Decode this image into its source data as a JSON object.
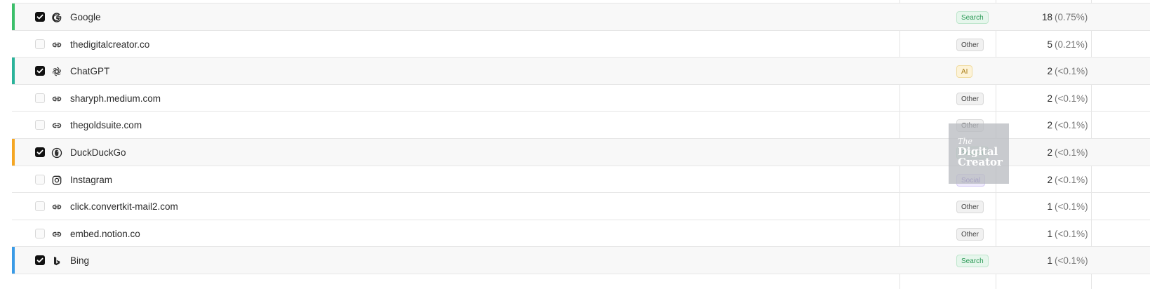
{
  "rows": [
    {
      "name": "Google",
      "checked": true,
      "icon": "google-icon",
      "accent": "#3cbf6a",
      "badge": "Search",
      "count": "18",
      "percent": "(0.75%)"
    },
    {
      "name": "thedigitalcreator.co",
      "checked": false,
      "icon": "link-icon",
      "accent": "",
      "badge": "Other",
      "count": "5",
      "percent": "(0.21%)"
    },
    {
      "name": "ChatGPT",
      "checked": true,
      "icon": "openai-icon",
      "accent": "#2bb39a",
      "badge": "AI",
      "count": "2",
      "percent": "(<0.1%)"
    },
    {
      "name": "sharyph.medium.com",
      "checked": false,
      "icon": "link-icon",
      "accent": "",
      "badge": "Other",
      "count": "2",
      "percent": "(<0.1%)"
    },
    {
      "name": "thegoldsuite.com",
      "checked": false,
      "icon": "link-icon",
      "accent": "",
      "badge": "Other",
      "count": "2",
      "percent": "(<0.1%)"
    },
    {
      "name": "DuckDuckGo",
      "checked": true,
      "icon": "duckduckgo-icon",
      "accent": "#f5a623",
      "badge": "Search",
      "count": "2",
      "percent": "(<0.1%)"
    },
    {
      "name": "Instagram",
      "checked": false,
      "icon": "instagram-icon",
      "accent": "",
      "badge": "Social",
      "count": "2",
      "percent": "(<0.1%)"
    },
    {
      "name": "click.convertkit-mail2.com",
      "checked": false,
      "icon": "link-icon",
      "accent": "",
      "badge": "Other",
      "count": "1",
      "percent": "(<0.1%)"
    },
    {
      "name": "embed.notion.co",
      "checked": false,
      "icon": "link-icon",
      "accent": "",
      "badge": "Other",
      "count": "1",
      "percent": "(<0.1%)"
    },
    {
      "name": "Bing",
      "checked": true,
      "icon": "bing-icon",
      "accent": "#3a9be6",
      "badge": "Search",
      "count": "1",
      "percent": "(<0.1%)"
    }
  ],
  "badge_styles": {
    "Search": {
      "bg": "#e6f6ec",
      "border": "#bfe6cd",
      "color": "#2e9a58"
    },
    "Other": {
      "bg": "#f1f1f1",
      "border": "#d9d9d9",
      "color": "#444444"
    },
    "AI": {
      "bg": "#fdf3d8",
      "border": "#f0dca0",
      "color": "#a87b12"
    },
    "Social": {
      "bg": "#efeafd",
      "border": "#d6ccf5",
      "color": "#6c4fd0"
    }
  },
  "watermark": {
    "line1": "The",
    "line2": "Digital",
    "line3": "Creator"
  }
}
